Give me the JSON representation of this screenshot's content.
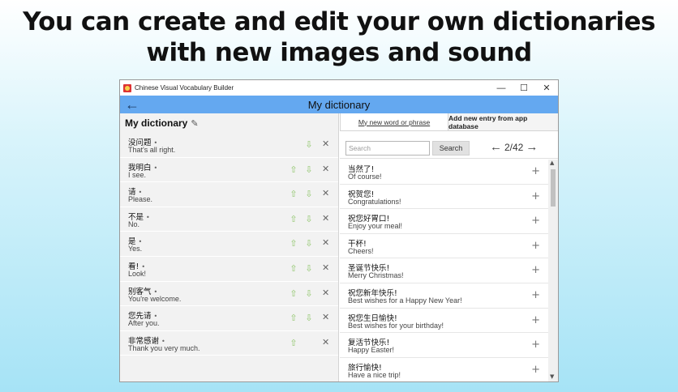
{
  "headline": {
    "line1": "You can create and edit your own dictionaries",
    "line2": "with new images and sound"
  },
  "window": {
    "title": "Chinese Visual Vocabulary Builder",
    "minimize": "—",
    "maximize": "☐",
    "close": "✕"
  },
  "appbar": {
    "back_icon": "←",
    "title": "My dictionary"
  },
  "left": {
    "title": "My dictionary",
    "pencil_icon": "✎",
    "up_icon": "⇧",
    "down_icon": "⇩",
    "delete_icon": "✕",
    "entries": [
      {
        "zh": "没问题",
        "en": "That's all right."
      },
      {
        "zh": "我明白",
        "en": "I see."
      },
      {
        "zh": "请",
        "en": "Please."
      },
      {
        "zh": "不是",
        "en": "No."
      },
      {
        "zh": "是",
        "en": "Yes."
      },
      {
        "zh": "看!",
        "en": "Look!"
      },
      {
        "zh": "别客气",
        "en": "You're welcome."
      },
      {
        "zh": "您先请",
        "en": "After you."
      },
      {
        "zh": "非常感谢",
        "en": "Thank you very much."
      }
    ],
    "dot": "•"
  },
  "right": {
    "tab_new": "My new word or phrase",
    "tab_database": "Add new entry from app database",
    "search_placeholder": "Search",
    "search_button": "Search",
    "pager_prev": "←",
    "pager_next": "→",
    "pager_text": "2/42",
    "add_icon": "+",
    "items": [
      {
        "zh": "当然了!",
        "en": "Of course!"
      },
      {
        "zh": "祝贺您!",
        "en": "Congratulations!"
      },
      {
        "zh": "祝您好胃口!",
        "en": "Enjoy your meal!"
      },
      {
        "zh": "干杯!",
        "en": "Cheers!"
      },
      {
        "zh": "圣诞节快乐!",
        "en": "Merry Christmas!"
      },
      {
        "zh": "祝您新年快乐!",
        "en": "Best wishes for a Happy New Year!"
      },
      {
        "zh": "祝您生日愉快!",
        "en": "Best wishes for your birthday!"
      },
      {
        "zh": "复活节快乐!",
        "en": "Happy Easter!"
      },
      {
        "zh": "旅行愉快!",
        "en": "Have a nice trip!"
      }
    ],
    "scroll_up": "▲",
    "scroll_down": "▼"
  },
  "colors": {
    "appbar": "#64a8f0",
    "arrow_green": "#8fc56a",
    "background_top": "#ffffff",
    "background_bottom": "#a6e3f6"
  }
}
